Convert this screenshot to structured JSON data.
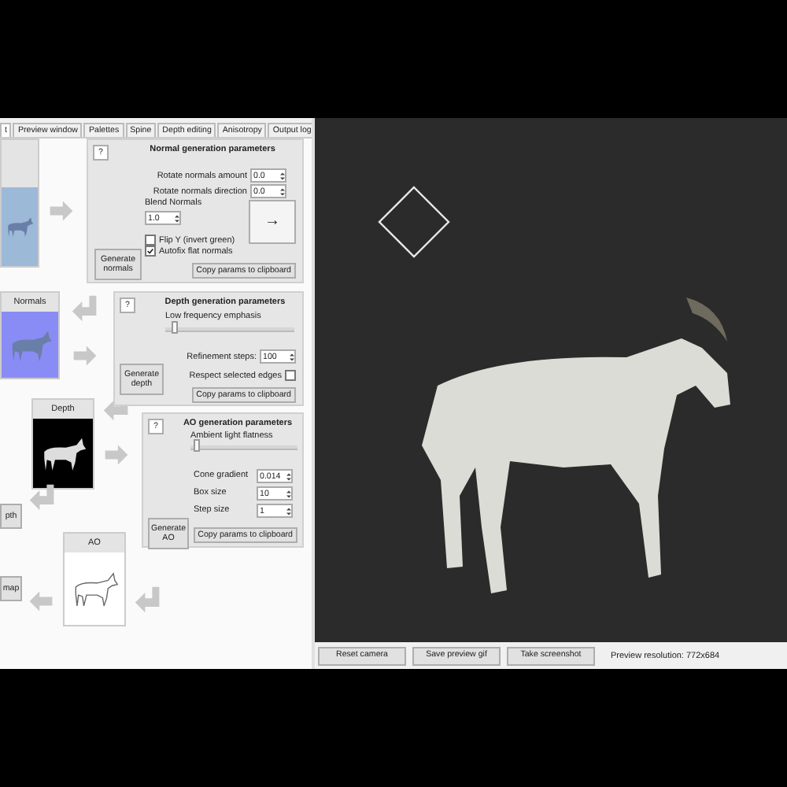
{
  "tabs": [
    {
      "label": "t",
      "selected": true
    },
    {
      "label": "Preview window",
      "selected": false
    },
    {
      "label": "Palettes",
      "selected": false
    },
    {
      "label": "Spine",
      "selected": false
    },
    {
      "label": "Depth editing",
      "selected": false
    },
    {
      "label": "Anisotropy",
      "selected": false
    },
    {
      "label": "Output log",
      "selected": false
    }
  ],
  "tiles": [
    {
      "kind": "source"
    },
    {
      "kind": "normals",
      "label": "Normals"
    },
    {
      "kind": "depth",
      "label": "Depth"
    },
    {
      "kind": "ao",
      "label": "AO"
    }
  ],
  "side_buttons": [
    "pth",
    "map"
  ],
  "normal_panel": {
    "help": "?",
    "title": "Normal generation parameters",
    "fields": [
      {
        "label": "Rotate normals amount",
        "value": "0.0"
      },
      {
        "label": "Rotate normals direction",
        "value": "0.0"
      }
    ],
    "blend": {
      "label": "Blend Normals",
      "value": "1.0"
    },
    "arrow_button": "→",
    "checks": [
      {
        "label": "Flip Y (invert green)",
        "checked": false
      },
      {
        "label": "Autofix flat normals",
        "checked": true
      }
    ],
    "generate": "Generate normals",
    "copy": "Copy params to clipboard"
  },
  "depth_panel": {
    "help": "?",
    "title": "Depth generation parameters",
    "slider": {
      "label": "Low frequency emphasis",
      "level": 0.05
    },
    "field": {
      "label": "Refinement steps:",
      "value": "100"
    },
    "check": {
      "label": "Respect selected edges",
      "checked": false
    },
    "generate": "Generate depth",
    "copy": "Copy params to clipboard"
  },
  "ao_panel": {
    "help": "?",
    "title": "AO generation parameters",
    "slider": {
      "label": "Ambient light flatness",
      "level": 0.03
    },
    "fields": [
      {
        "label": "Cone gradient",
        "value": "0.014"
      },
      {
        "label": "Box size",
        "value": "10"
      },
      {
        "label": "Step size",
        "value": "1"
      }
    ],
    "generate": "Generate AO",
    "copy": "Copy params to clipboard"
  },
  "preview_buttons": [
    "Reset camera",
    "Save preview gif",
    "Take screenshot"
  ],
  "preview_resolution": "Preview resolution: 772x684"
}
